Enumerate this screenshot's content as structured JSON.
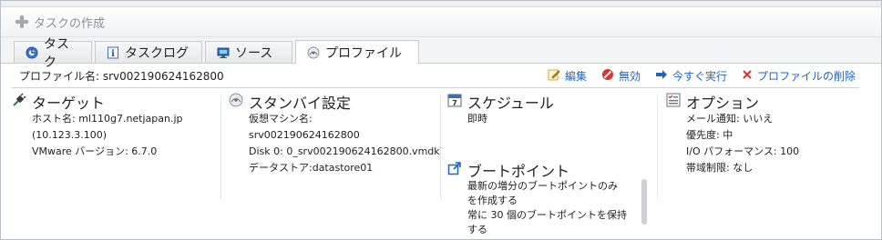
{
  "header": {
    "create_task_label": "タスクの作成"
  },
  "tabs": [
    {
      "label": "タスク",
      "icon": "task-icon"
    },
    {
      "label": "タスクログ",
      "icon": "info-icon"
    },
    {
      "label": "ソース",
      "icon": "source-icon"
    },
    {
      "label": "プロファイル",
      "icon": "profile-icon",
      "active": true
    }
  ],
  "profile": {
    "name_label": "プロファイル名: srv002190624162800"
  },
  "actions": {
    "edit": "編集",
    "disable": "無効",
    "run_now": "今すぐ実行",
    "delete": "プロファイルの削除"
  },
  "target": {
    "title": "ターゲット",
    "host": "ホスト名: ml110g7.netjapan.jp",
    "ip": "(10.123.3.100)",
    "vmware": "VMware バージョン: 6.7.0"
  },
  "standby": {
    "title": "スタンバイ設定",
    "vm_label": "仮想マシン名:",
    "vm_name": "srv002190624162800",
    "disk": "Disk 0: 0_srv002190624162800.vmdk",
    "datastore": "データストア:datastore01"
  },
  "schedule": {
    "title": "スケジュール",
    "value": "即時"
  },
  "bootpoint": {
    "title": "ブートポイント",
    "line1": "最新の増分のブートポイントのみ",
    "line2": "を作成する",
    "line3": "常に 30 個のブートポイントを保持",
    "line4": "する"
  },
  "options": {
    "title": "オプション",
    "mail": "メール通知: いいえ",
    "priority": "優先度: 中",
    "io": "I/O パフォーマンス: 100",
    "bandwidth": "帯域制限: なし"
  },
  "colors": {
    "link": "#1f63c6",
    "disable_red": "#d9352b",
    "delete_red": "#d9352b",
    "border": "#c8ccd1"
  }
}
